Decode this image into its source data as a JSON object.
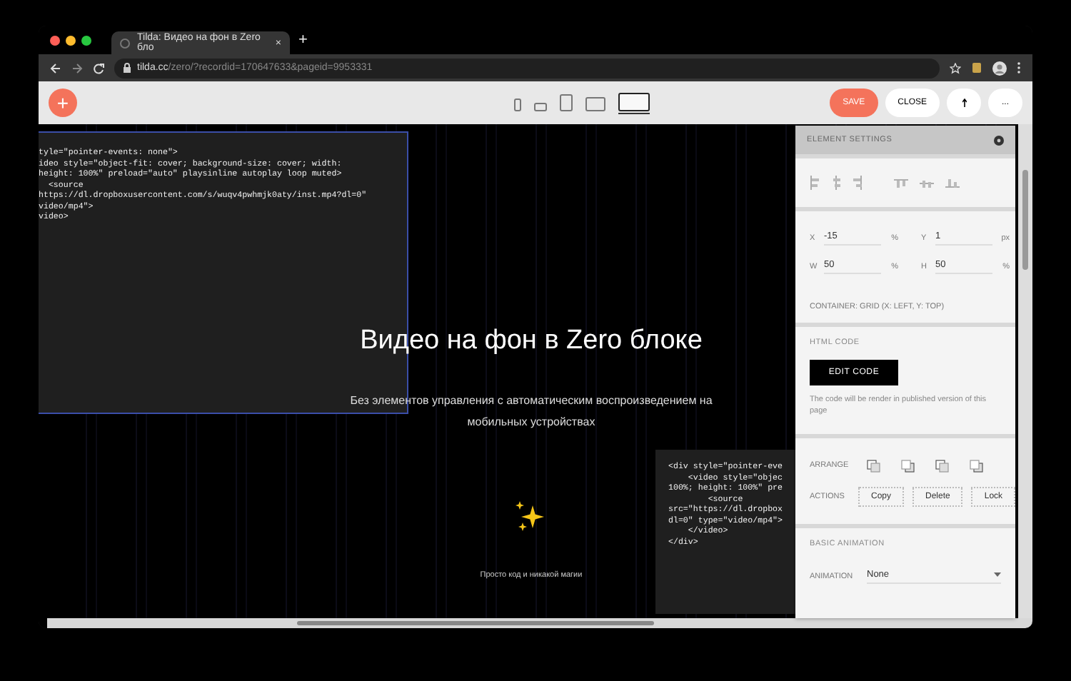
{
  "browser": {
    "tab": {
      "title": "Tilda: Видео на фон в Zero бло",
      "selected": true,
      "close": "×"
    },
    "new_tab": "+",
    "url": {
      "host": "tilda.cc",
      "path": "/zero/?recordid=170647633&pageid=9953331"
    }
  },
  "toolbar": {
    "add": "+",
    "devices": [
      {
        "kind": "phone",
        "selected": false
      },
      {
        "kind": "phone-landscape",
        "selected": false
      },
      {
        "kind": "tablet",
        "selected": false
      },
      {
        "kind": "tablet-landscape",
        "selected": false
      },
      {
        "kind": "desktop",
        "selected": true
      }
    ],
    "buttons": [
      {
        "kind": "primary",
        "label": "SAVE"
      },
      {
        "kind": "plain",
        "label": "CLOSE"
      },
      {
        "kind": "icon"
      },
      {
        "kind": "plain",
        "label": "..."
      }
    ]
  },
  "canvas": {
    "code_block": {
      "selected": true,
      "lines": [
        "tyle=\"pointer-events: none\">",
        "ideo style=\"object-fit: cover; background-size: cover; width:",
        "height: 100%\" preload=\"auto\" playsinline autoplay loop muted>",
        "  <source",
        "https://dl.dropboxusercontent.com/s/wuqv4pwhmjk0aty/inst.mp4?dl=0\"",
        "video/mp4\">",
        "video>"
      ]
    },
    "title": "Видео на фон в Zero блоке",
    "subtitle": "Без элементов управления с автоматическим воспроизведением на мобильных устройствах",
    "caption": "Просто код и никакой магии",
    "code_block_2": {
      "selected": false,
      "lines": [
        "<div style=\"pointer-eve",
        "    <video style=\"objec",
        "100%; height: 100%\" pre",
        "        <source",
        "src=\"https://dl.dropbox",
        "dl=0\" type=\"video/mp4\">",
        "    </video>",
        "</div>"
      ]
    }
  },
  "panel": {
    "title": "ELEMENT SETTINGS",
    "fields": [
      {
        "label": "X",
        "value": "-15",
        "unit": "%"
      },
      {
        "label": "Y",
        "value": "1",
        "unit": "px"
      },
      {
        "label": "W",
        "value": "50",
        "unit": "%"
      },
      {
        "label": "H",
        "value": "50",
        "unit": "%"
      }
    ],
    "container": "CONTAINER: GRID (X: LEFT, Y: TOP)",
    "html_code": {
      "heading": "HTML CODE",
      "button": "EDIT CODE",
      "note": "The code will be render in published version of this page"
    },
    "arrange": {
      "label": "ARRANGE"
    },
    "actions": {
      "label": "ACTIONS",
      "buttons": [
        "Copy",
        "Delete",
        "Lock"
      ]
    },
    "animation": {
      "heading": "BASIC ANIMATION",
      "label": "ANIMATION",
      "value": "None"
    }
  }
}
